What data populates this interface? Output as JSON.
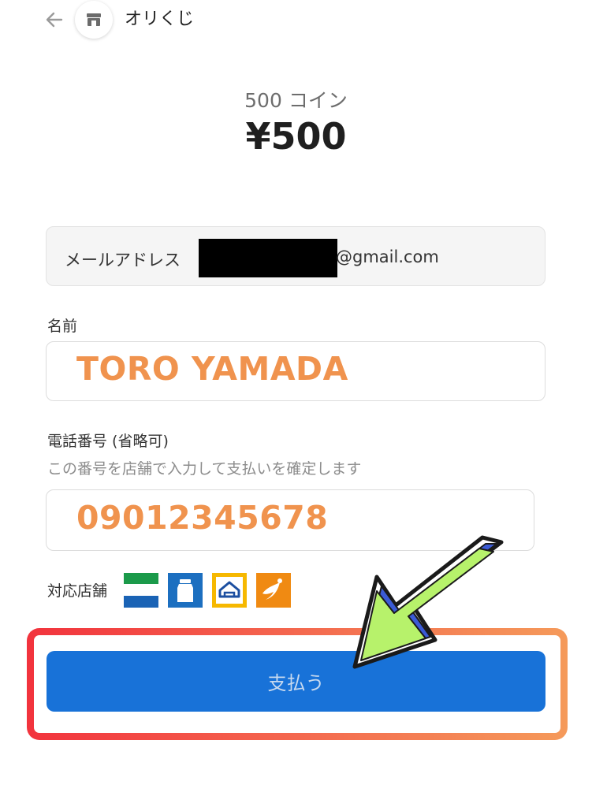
{
  "header": {
    "back_icon": "arrow-left-icon",
    "store_icon": "storefront-icon",
    "title": "オリくじ"
  },
  "amount": {
    "coin_label": "500 コイン",
    "price": "¥500"
  },
  "email": {
    "label": "メールアドレス",
    "value_suffix": "@gmail.com"
  },
  "name": {
    "label": "名前",
    "value": "TORO YAMADA"
  },
  "phone": {
    "label": "電話番号 (省略可)",
    "help": "この番号を店舗で入力して支払いを確定します",
    "value": "09012345678"
  },
  "stores": {
    "label": "対応店舗",
    "icons": [
      "familymart-icon",
      "ministop-icon",
      "lawson-icon",
      "seicomart-icon"
    ]
  },
  "pay_button": {
    "label": "支払う"
  },
  "colors": {
    "price_text": "#1f1f1f",
    "input_value": "#f0934e",
    "pay_button": "#1872d8",
    "highlight_start": "#f2333d",
    "highlight_end": "#f59a5a",
    "arrow_fill": "#b7f26b",
    "arrow_accent": "#3b5bd6"
  }
}
